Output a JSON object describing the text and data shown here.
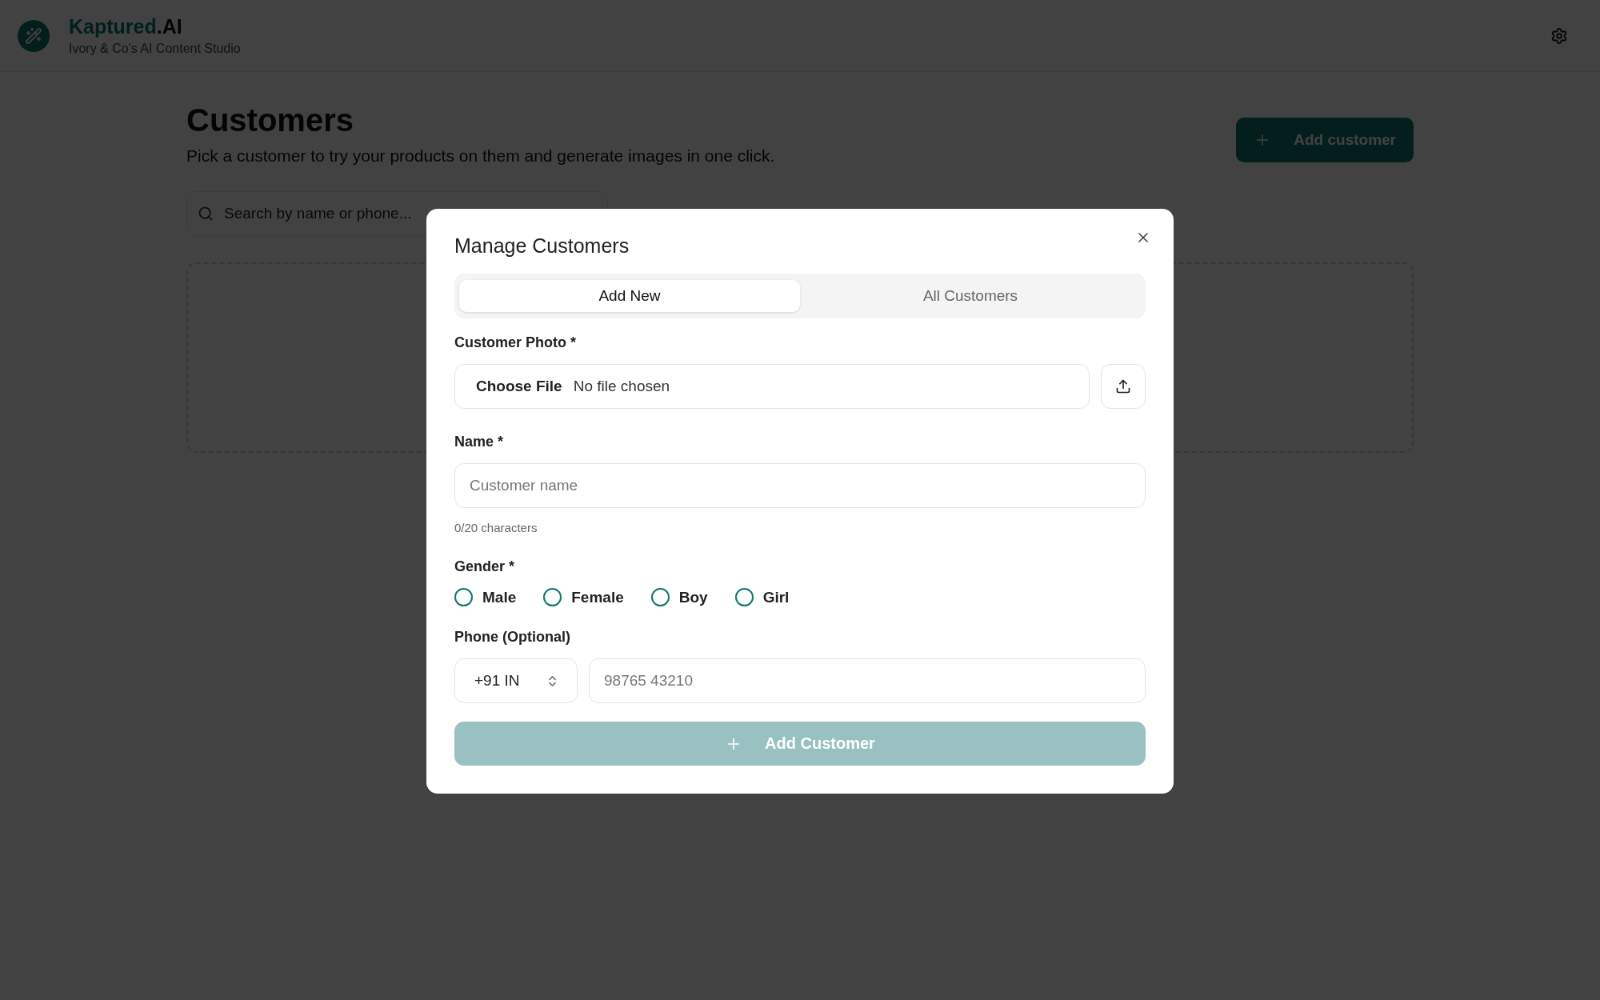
{
  "header": {
    "brand": {
      "name": "Kaptured",
      "suffix": ".AI"
    },
    "subtitle": "Ivory & Co's AI Content Studio"
  },
  "page": {
    "title": "Customers",
    "description": "Pick a customer to try your products on them and generate images in one click.",
    "add_button": "Add customer",
    "search": {
      "placeholder": "Search by name or phone..."
    }
  },
  "dialog": {
    "title": "Manage Customers",
    "tabs": [
      {
        "label": "Add New",
        "selected": true
      },
      {
        "label": "All Customers",
        "selected": false
      }
    ],
    "photo": {
      "label": "Customer Photo *",
      "choose": "Choose File",
      "status": "No file chosen"
    },
    "name": {
      "label": "Name *",
      "placeholder": "Customer name",
      "counter": "0/20 characters"
    },
    "gender": {
      "label": "Gender *",
      "options": [
        {
          "label": "Male",
          "selected": false
        },
        {
          "label": "Female",
          "selected": false
        },
        {
          "label": "Boy",
          "selected": false
        },
        {
          "label": "Girl",
          "selected": false
        }
      ]
    },
    "phone": {
      "label": "Phone (Optional)",
      "country": "+91 IN",
      "placeholder": "98765 43210"
    },
    "submit": {
      "label": "Add Customer",
      "disabled": true
    }
  }
}
